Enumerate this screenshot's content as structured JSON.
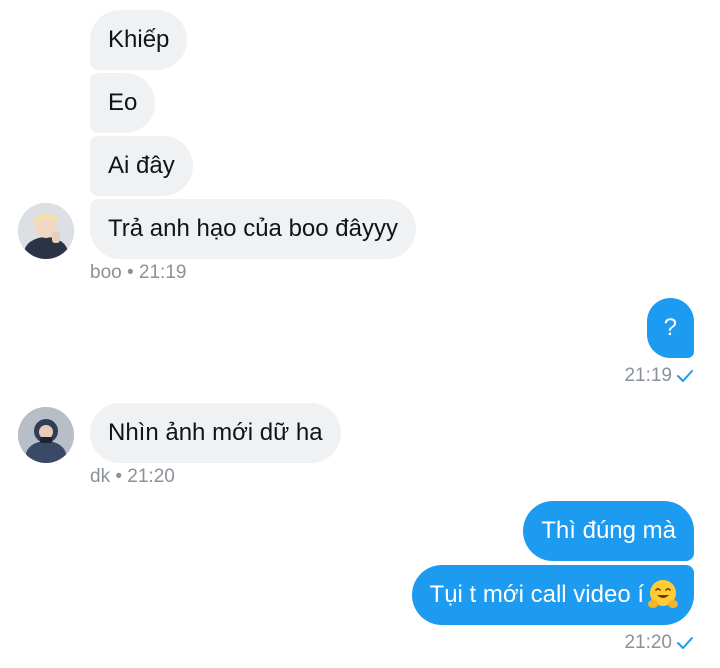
{
  "messages": [
    {
      "text": "Khiếp"
    },
    {
      "text": "Eo"
    },
    {
      "text": "Ai đây"
    },
    {
      "text": "Trả anh hạo của boo đâyyy"
    },
    {
      "text": "?"
    },
    {
      "text": "Nhìn ảnh mới dữ ha"
    },
    {
      "text": "Thì đúng mà"
    },
    {
      "text": "Tụi t mới call video í"
    }
  ],
  "meta": {
    "boo": "boo • 21:19",
    "out1": "21:19",
    "dk": "dk • 21:20",
    "out2": "21:20"
  },
  "icons": {
    "read": "checkmark-icon",
    "emoji": "hugging-face-emoji"
  },
  "colors": {
    "outgoing": "#1d9bf0",
    "incoming": "#eff1f3"
  }
}
